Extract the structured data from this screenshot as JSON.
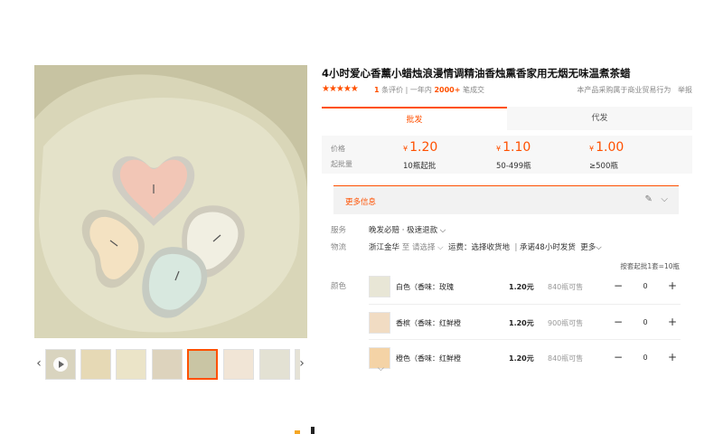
{
  "product": {
    "title": "4小时爱心香薰小蜡烛浪漫情调精油香烛熏香家用无烟无味温煮茶蜡",
    "stars": "★★★★★",
    "review_count": "1",
    "review_label": "条评价",
    "divider": "|",
    "year_label": "一年内",
    "sold_count": "2000+",
    "sold_label": "笔成交",
    "trade_note": "本产品采购属于商业贸易行为",
    "report": "举报"
  },
  "tabs": [
    {
      "label": "批发"
    },
    {
      "label": "代发"
    }
  ],
  "pricing": {
    "price_label": "价格",
    "qty_label": "起批量",
    "currency": "¥",
    "tiers": [
      {
        "price": "1.20",
        "range": "10瓶起批"
      },
      {
        "price": "1.10",
        "range": "50-499瓶"
      },
      {
        "price": "1.00",
        "range": "≥500瓶"
      }
    ]
  },
  "more_info": {
    "label": "更多信息",
    "edit_icon": "✎",
    "chevron": "⌵"
  },
  "service": {
    "label": "服务",
    "value": "晚发必赔 · 极速退款 ⌵"
  },
  "logistics": {
    "label": "物流",
    "origin": "浙江金华",
    "to": "至",
    "select": "请选择",
    "chevron": "⌵",
    "fee": "运费：选择收货地",
    "ship": "承诺48小时发货",
    "more": "更多⌵"
  },
  "combo_note": "按套起批1套=10瓶",
  "color_label": "颜色",
  "skus": [
    {
      "name": "白色（香味：玫瑰",
      "price": "1.20元",
      "stock": "840瓶可售",
      "qty": "0",
      "swatch": "#e8e6d6"
    },
    {
      "name": "香槟（香味：红鲜橙",
      "price": "1.20元",
      "stock": "900瓶可售",
      "qty": "0",
      "swatch": "#f1dcc3"
    },
    {
      "name": "橙色（香味：红鲜橙",
      "price": "1.20元",
      "stock": "840瓶可售",
      "qty": "0",
      "swatch": "#f4d3a6"
    }
  ],
  "controls": {
    "minus": "−",
    "plus": "+",
    "expand": "⌵"
  },
  "gallery": {
    "prev": "‹",
    "next": "›",
    "thumb_count": 8
  },
  "colors": {
    "accent": "#ff5000",
    "price": "#ff5000"
  }
}
